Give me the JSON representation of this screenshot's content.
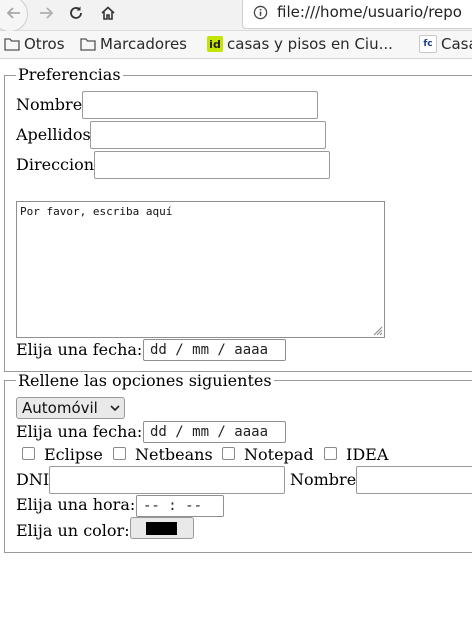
{
  "browser": {
    "url": "file:///home/usuario/repo",
    "bookmarks": [
      {
        "label": "Otros",
        "icon": "folder-icon"
      },
      {
        "label": "Marcadores",
        "icon": "folder-icon"
      },
      {
        "label": "casas y pisos en Ciu...",
        "icon": "idealista-favicon",
        "favicon_text": "id"
      },
      {
        "label": "Casa",
        "icon": "fotocasa-favicon",
        "favicon_text": "fc"
      }
    ]
  },
  "form1": {
    "legend": "Preferencias",
    "nombre_label": "Nombre",
    "apellidos_label": "Apellidos",
    "direccion_label": "Direccion",
    "textarea_value": "Por favor, escriba aquí",
    "fecha_label": "Elija una fecha:",
    "fecha_placeholder": "dd / mm / aaaa"
  },
  "form2": {
    "legend": "Rellene las opciones siguientes",
    "select_value": "Automóvil",
    "fecha_label": "Elija una fecha:",
    "fecha_placeholder": "dd / mm / aaaa",
    "checkboxes": [
      {
        "label": "Eclipse",
        "checked": false
      },
      {
        "label": "Netbeans",
        "checked": false
      },
      {
        "label": "Notepad",
        "checked": false
      },
      {
        "label": "IDEA",
        "checked": false
      }
    ],
    "dni_label": "DNI",
    "nombre_label": "Nombre",
    "hora_label": "Elija una hora:",
    "hora_placeholder": "-- : --",
    "color_label": "Elija un color:",
    "color_value": "#000000"
  },
  "colors": {
    "chrome_bg": "#f2f2f2",
    "field_border": "#9a9a9a",
    "idealista_fav": "#c5e400"
  }
}
